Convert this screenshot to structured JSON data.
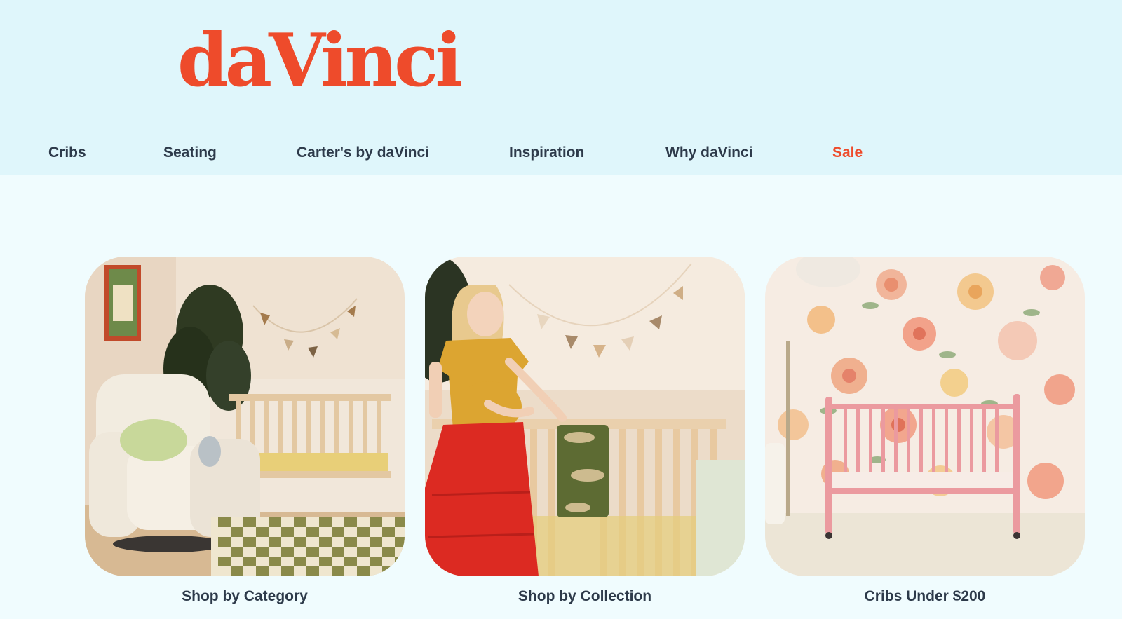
{
  "brand": {
    "logo_text": "daVinci",
    "accent_color": "#ee4b2b"
  },
  "nav": {
    "items": [
      {
        "label": "Cribs"
      },
      {
        "label": "Seating"
      },
      {
        "label": "Carter's by daVinci"
      },
      {
        "label": "Inspiration"
      },
      {
        "label": "Why daVinci"
      },
      {
        "label": "Sale",
        "color": "#ee4b2b"
      }
    ]
  },
  "cards": [
    {
      "caption": "Shop by Category",
      "image": "nursery-glider-crib-photo"
    },
    {
      "caption": "Shop by Collection",
      "image": "pregnant-woman-at-crib-photo"
    },
    {
      "caption": "Cribs Under $200",
      "image": "pink-crib-floral-wallpaper-photo"
    }
  ]
}
